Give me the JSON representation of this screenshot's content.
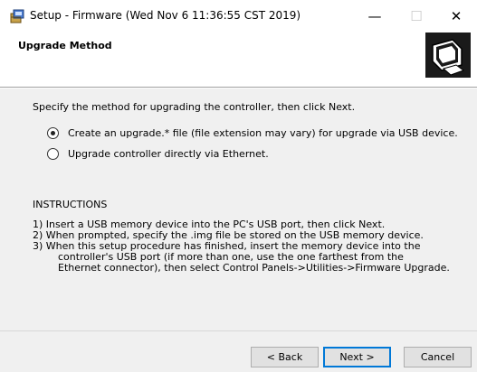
{
  "window": {
    "title": "Setup - Firmware (Wed Nov  6 11:36:55 CST 2019)",
    "minimize_glyph": "—",
    "maximize_glyph": "☐",
    "close_glyph": "✕"
  },
  "header": {
    "title": "Upgrade Method"
  },
  "main": {
    "intro": "Specify the method for upgrading the controller, then click Next.",
    "options": [
      {
        "label": "Create an upgrade.* file (file extension may vary) for upgrade via USB device.",
        "selected": true
      },
      {
        "label": "Upgrade controller directly via Ethernet.",
        "selected": false
      }
    ],
    "instructions_heading": "INSTRUCTIONS",
    "instructions": [
      "1) Insert a USB memory device into the PC's USB port, then click Next.",
      "2) When prompted, specify the .img file be stored on the USB memory device.",
      "3) When this setup procedure has finished, insert the memory device into the",
      "controller's USB port (if more than one, use the one farthest from the",
      "Ethernet connector), then select Control Panels->Utilities->Firmware Upgrade."
    ]
  },
  "footer": {
    "back_label": "< Back",
    "next_label": "Next >",
    "cancel_label": "Cancel"
  },
  "icons": {
    "app": "setup-package-icon",
    "logo": "computer-monitor-icon"
  }
}
